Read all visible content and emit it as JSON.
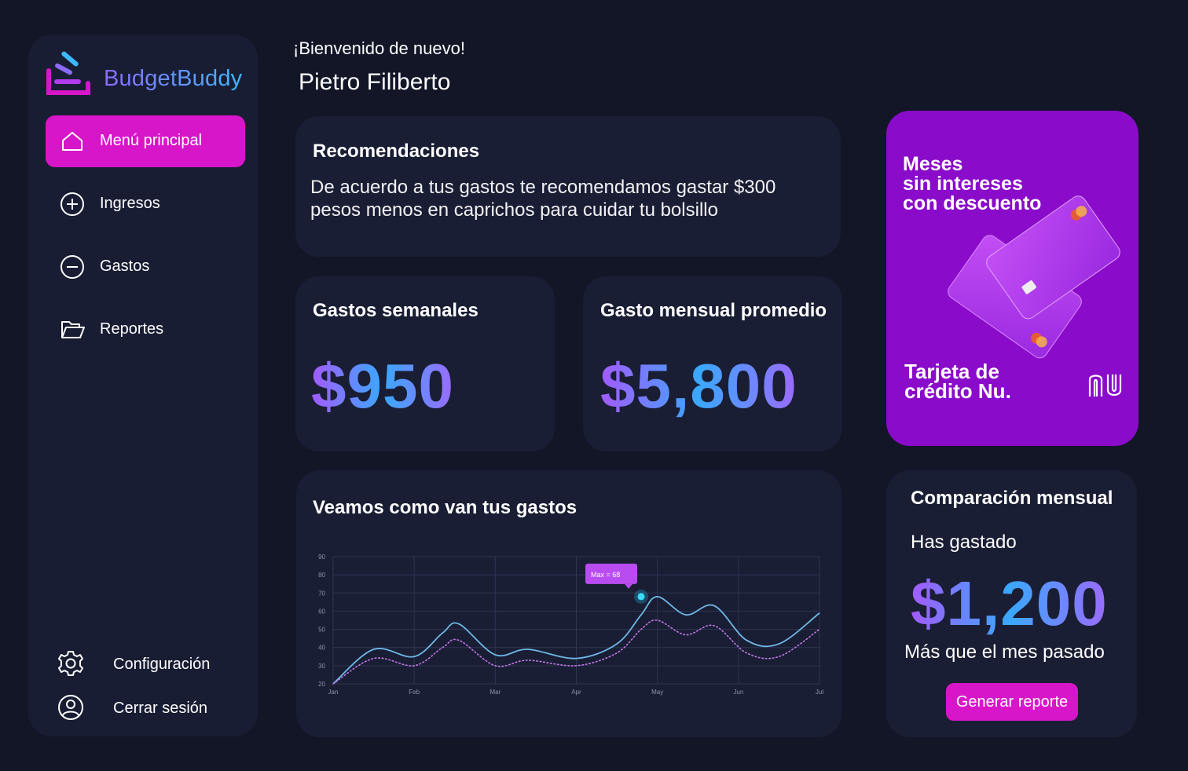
{
  "app": {
    "brand": "BudgetBuddy",
    "accent_color": "#d816c9",
    "background_color": "#121627",
    "card_color": "#191e34"
  },
  "sidebar": {
    "items": [
      {
        "label": "Menú principal",
        "icon": "home-icon",
        "active": true
      },
      {
        "label": "Ingresos",
        "icon": "plus-circle-icon",
        "active": false
      },
      {
        "label": "Gastos",
        "icon": "minus-circle-icon",
        "active": false
      },
      {
        "label": "Reportes",
        "icon": "folder-open-icon",
        "active": false
      }
    ],
    "bottom_items": [
      {
        "label": "Configuración",
        "icon": "gear-icon"
      },
      {
        "label": "Cerrar sesión",
        "icon": "user-circle-icon"
      }
    ]
  },
  "header": {
    "greeting": "¡Bienvenido de nuevo!",
    "user_name": "Pietro Filiberto"
  },
  "recommendations": {
    "title": "Recomendaciones",
    "text": "De acuerdo a tus gastos te recomendamos gastar $300 pesos menos en caprichos para cuidar tu bolsillo"
  },
  "weekly": {
    "title": "Gastos semanales",
    "value": "$950"
  },
  "monthly_avg": {
    "title": "Gasto mensual promedio",
    "value": "$5,800"
  },
  "promo": {
    "headline_1": "Meses",
    "headline_2": "sin intereses",
    "headline_3": "con descuento",
    "card_name": "Tarjeta de crédito Nu.",
    "logo_text": "nu",
    "background_color": "#8a0bc9"
  },
  "comparison": {
    "title": "Comparación mensual",
    "subtitle": "Has gastado",
    "value": "$1,200",
    "caption": "Más que el mes pasado",
    "button_label": "Generar reporte"
  },
  "expenses_chart": {
    "title": "Veamos como van tus gastos",
    "tooltip": "Max = 68"
  },
  "chart_data": {
    "type": "line",
    "x": [
      "Jan",
      "Feb",
      "Mar",
      "Apr",
      "May",
      "Jun",
      "Jul"
    ],
    "x_numeric": [
      0,
      0.5,
      1,
      1.35,
      1.55,
      2,
      2.4,
      3,
      3.5,
      3.8,
      4,
      4.35,
      4.7,
      5.1,
      5.5,
      6
    ],
    "ylim": [
      20,
      90
    ],
    "yticks": [
      20,
      30,
      40,
      50,
      60,
      70,
      80,
      90
    ],
    "grid": true,
    "series": [
      {
        "values": [
          20,
          39,
          35,
          48,
          53,
          36,
          39,
          34,
          42,
          58,
          68,
          58,
          63,
          44,
          42,
          59
        ],
        "color": "#6fb8e6",
        "style": "solid"
      },
      {
        "values": [
          20,
          34,
          30,
          40,
          44,
          30,
          33,
          30,
          37,
          50,
          55,
          47,
          52,
          37,
          35,
          50
        ],
        "color": "#c678e8",
        "style": "dotted"
      }
    ],
    "highlight": {
      "x": 3.8,
      "y": 68
    }
  }
}
